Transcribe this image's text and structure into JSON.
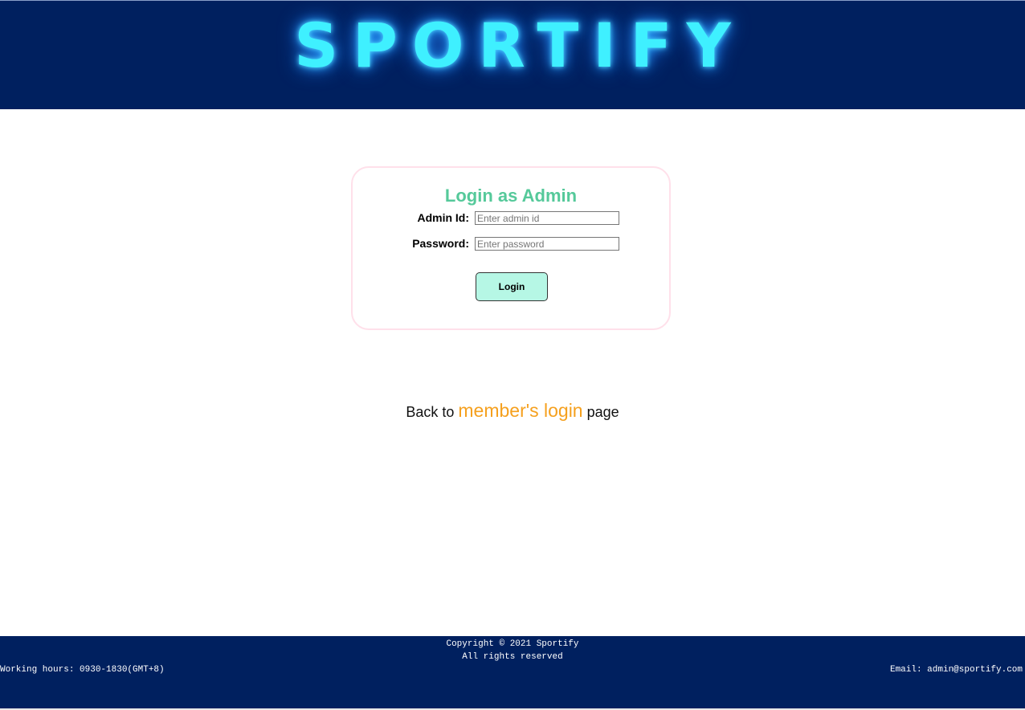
{
  "header": {
    "logo_text": "SPORTIFY"
  },
  "login": {
    "title": "Login as Admin",
    "admin_id_label": "Admin Id:",
    "admin_id_placeholder": "Enter admin id",
    "admin_id_value": "",
    "password_label": "Password:",
    "password_placeholder": "Enter password",
    "password_value": "",
    "button_label": "Login"
  },
  "back": {
    "prefix": "Back to ",
    "link_text": "member's login",
    "suffix": " page"
  },
  "footer": {
    "copyright": "Copyright © 2021 Sportify",
    "rights": "All rights reserved",
    "hours": "Working hours: 0930-1830(GMT+8)",
    "email": "Email: admin@sportify.com"
  },
  "colors": {
    "header_bg": "#00205f",
    "logo_glow": "#3ff0ff",
    "title_green": "#55c99a",
    "button_bg": "#b6f7e5",
    "link_orange": "#f5a01e",
    "card_border": "#ffe0ea"
  }
}
